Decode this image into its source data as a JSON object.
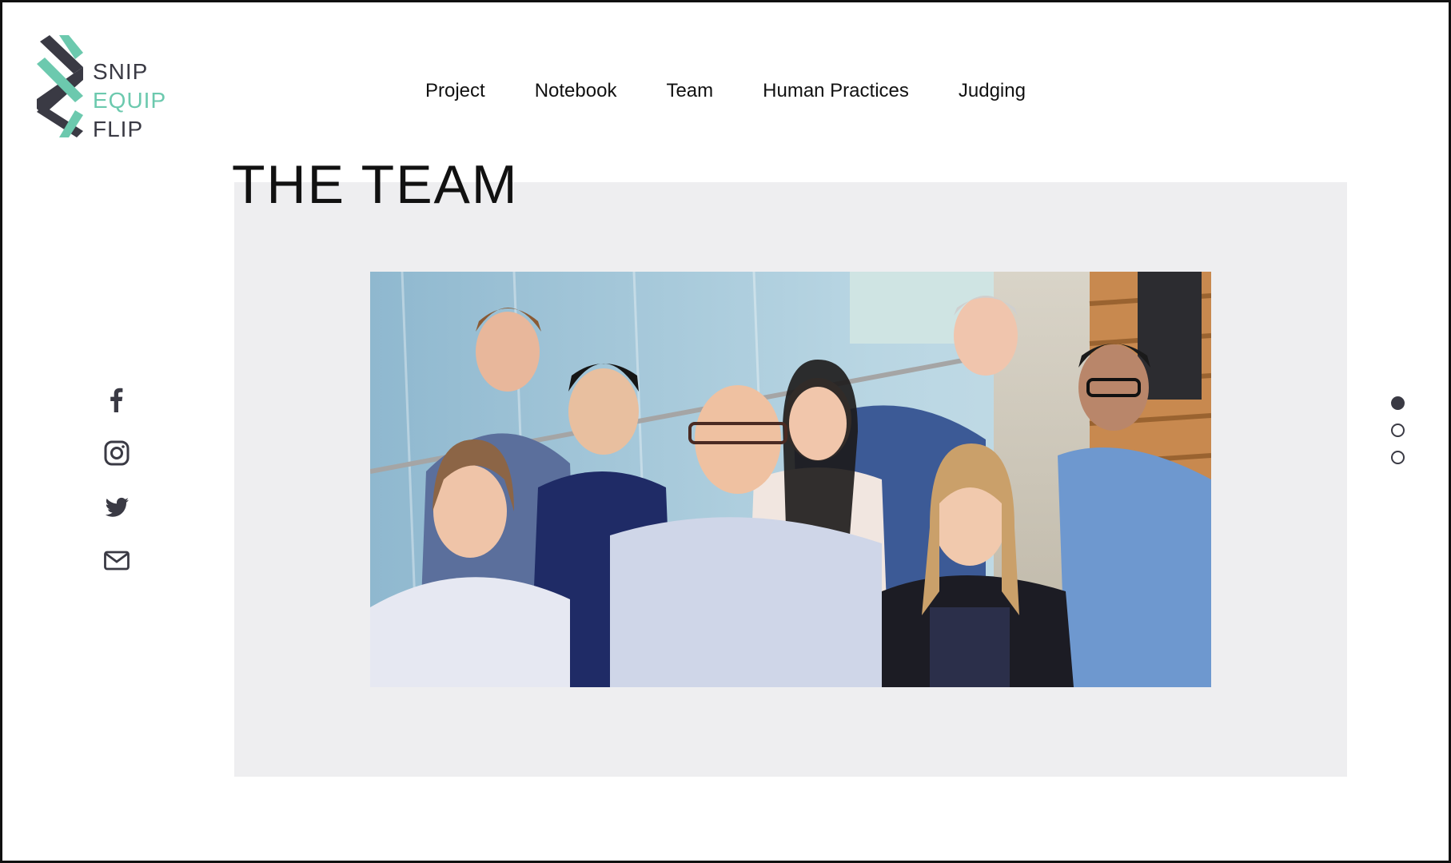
{
  "logo": {
    "line1": "SNIP",
    "line2": "EQUIP",
    "line3": "FLIP",
    "colors": {
      "dark": "#3a3a44",
      "accent": "#6cc9ae"
    }
  },
  "nav": {
    "items": [
      {
        "label": "Project"
      },
      {
        "label": "Notebook"
      },
      {
        "label": "Team"
      },
      {
        "label": "Human Practices"
      },
      {
        "label": "Judging"
      }
    ]
  },
  "page": {
    "title": "THE TEAM",
    "panel_color": "#eeeef0"
  },
  "photo": {
    "description_icon": "team-photo"
  },
  "social": {
    "icons": [
      "facebook-icon",
      "instagram-icon",
      "twitter-icon",
      "email-icon"
    ]
  },
  "slides": {
    "count": 3,
    "active_index": 0
  }
}
